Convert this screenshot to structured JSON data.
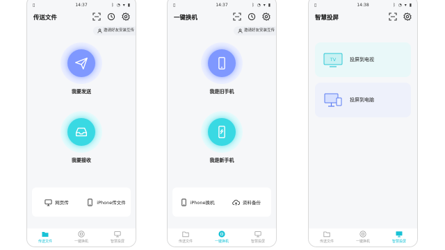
{
  "colors": {
    "accent": "#18c2d6",
    "blue_disc": "#7f98ff",
    "cyan_disc": "#39d9e3",
    "inactive": "#9a9a9a"
  },
  "screens": [
    {
      "status": {
        "left": "▯",
        "time": "14:37",
        "right": "ᛒ ◔ ▾ ▮"
      },
      "title": "传送文件",
      "invite": "邀请好友安装互传",
      "primary": {
        "label": "我要发送",
        "icon": "paper-plane-icon"
      },
      "secondary": {
        "label": "我要接收",
        "icon": "inbox-tray-icon"
      },
      "tools": [
        {
          "label": "网页传",
          "icon": "monitor-icon"
        },
        {
          "label": "iPhone传文件",
          "icon": "phone-icon"
        }
      ],
      "tabs": [
        {
          "label": "传送文件",
          "active": true
        },
        {
          "label": "一键换机",
          "active": false
        },
        {
          "label": "智慧投屏",
          "active": false
        }
      ]
    },
    {
      "status": {
        "left": "▯",
        "time": "14:37",
        "right": "ᛒ ◔ ▾ ▮"
      },
      "title": "一键换机",
      "invite": "邀请好友安装互传",
      "primary": {
        "label": "我是旧手机",
        "icon": "old-phone-icon"
      },
      "secondary": {
        "label": "我是新手机",
        "icon": "new-phone-icon"
      },
      "tools": [
        {
          "label": "iPhone换机",
          "icon": "phone-icon"
        },
        {
          "label": "资料备份",
          "icon": "cloud-upload-icon"
        }
      ],
      "tabs": [
        {
          "label": "传送文件",
          "active": false
        },
        {
          "label": "一键换机",
          "active": true
        },
        {
          "label": "智慧投屏",
          "active": false
        }
      ]
    },
    {
      "status": {
        "left": "▯",
        "time": "14:38",
        "right": "ᛒ ◔ ▾ ▮"
      },
      "title": "智慧投屏",
      "cards": [
        {
          "label": "投屏到电视",
          "icon": "tv-icon",
          "tv_text": "TV"
        },
        {
          "label": "投屏到电脑",
          "icon": "computer-icon"
        }
      ],
      "tabs": [
        {
          "label": "传送文件",
          "active": false
        },
        {
          "label": "一键换机",
          "active": false
        },
        {
          "label": "智慧投屏",
          "active": true
        }
      ]
    }
  ]
}
